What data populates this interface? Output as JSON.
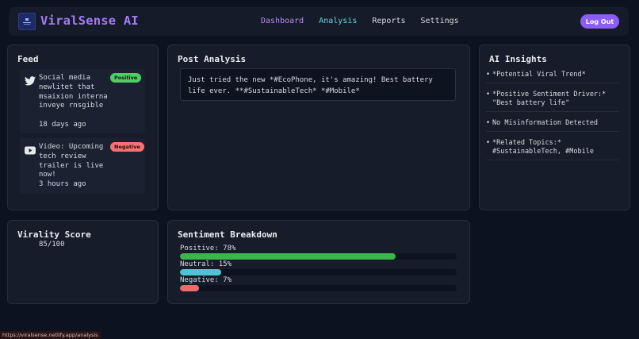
{
  "app": {
    "title": "ViralSense AI"
  },
  "nav": {
    "links": [
      "Dashboard",
      "Analysis",
      "Reports",
      "Settings"
    ],
    "logout_label": "Log Out"
  },
  "feed": {
    "title": "Feed",
    "items": [
      {
        "icon": "twitter-icon",
        "text": "Social media newlitet that msaixion interna inveye rnsgible",
        "time": "18 days ago",
        "badge": "Positive"
      },
      {
        "icon": "youtube-icon",
        "text": "Video: Upcoming tech review trailer is live now!",
        "time": "3 hours ago",
        "badge": "Negative"
      }
    ]
  },
  "post_analysis": {
    "title": "Post Analysis",
    "text": "Just tried the new *#EcoPhone, it's amazing! Best battery life ever. **#SustainableTech* *#Mobile*"
  },
  "insights": {
    "title": "AI Insights",
    "items": [
      "*Potential Viral Trend*",
      "*Positive Sentiment Driver:* \"Best battery life\"",
      "No Misinformation Detected",
      "*Related Topics:* #SustainableTech, #Mobile"
    ]
  },
  "virality": {
    "title": "Virality Score",
    "value": "85/100"
  },
  "sentiment": {
    "title": "Sentiment Breakdown",
    "rows": [
      {
        "label": "Positive: 78%",
        "percent": 78,
        "color": "#3cb54a"
      },
      {
        "label": "Neutral: 15%",
        "percent": 15,
        "color": "#4fc3d4"
      },
      {
        "label": "Negative: 7%",
        "percent": 7,
        "color": "#ee6b6b"
      }
    ]
  },
  "status_url": "https://viralsense.netlify.app/analysis",
  "colors": {
    "accent": "#8b5cf6",
    "brand": "#a47cf6",
    "active_link": "#6dd3e6",
    "background": "#0d1220"
  }
}
